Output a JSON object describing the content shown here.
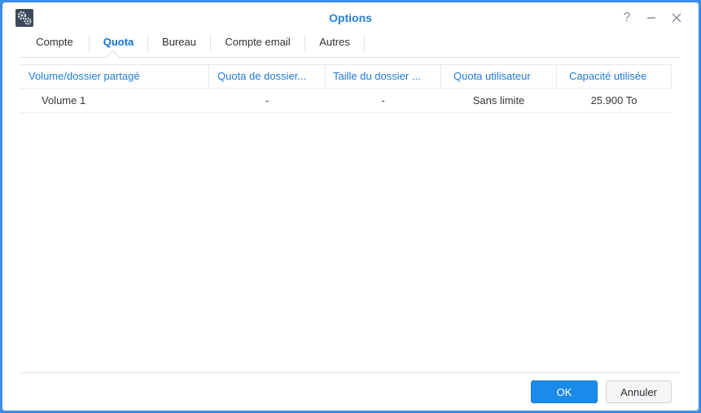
{
  "window": {
    "title": "Options",
    "help_icon": "question-mark-icon",
    "minimize_icon": "minimize-icon",
    "close_icon": "close-icon",
    "app_icon": "gears-icon"
  },
  "tabs": [
    {
      "label": "Compte",
      "active": false
    },
    {
      "label": "Quota",
      "active": true
    },
    {
      "label": "Bureau",
      "active": false
    },
    {
      "label": "Compte email",
      "active": false
    },
    {
      "label": "Autres",
      "active": false
    }
  ],
  "table": {
    "columns": [
      "Volume/dossier partagé",
      "Quota de dossier...",
      "Taille du dossier ...",
      "Quota utilisateur",
      "Capacité utilisée"
    ],
    "rows": [
      [
        "Volume 1",
        "-",
        "-",
        "Sans limite",
        "25.900 To"
      ]
    ]
  },
  "buttons": {
    "ok": "OK",
    "cancel": "Annuler"
  },
  "colors": {
    "accent": "#0f72d1",
    "primary_button": "#1b8bea",
    "window_border": "#3a8ee6"
  }
}
